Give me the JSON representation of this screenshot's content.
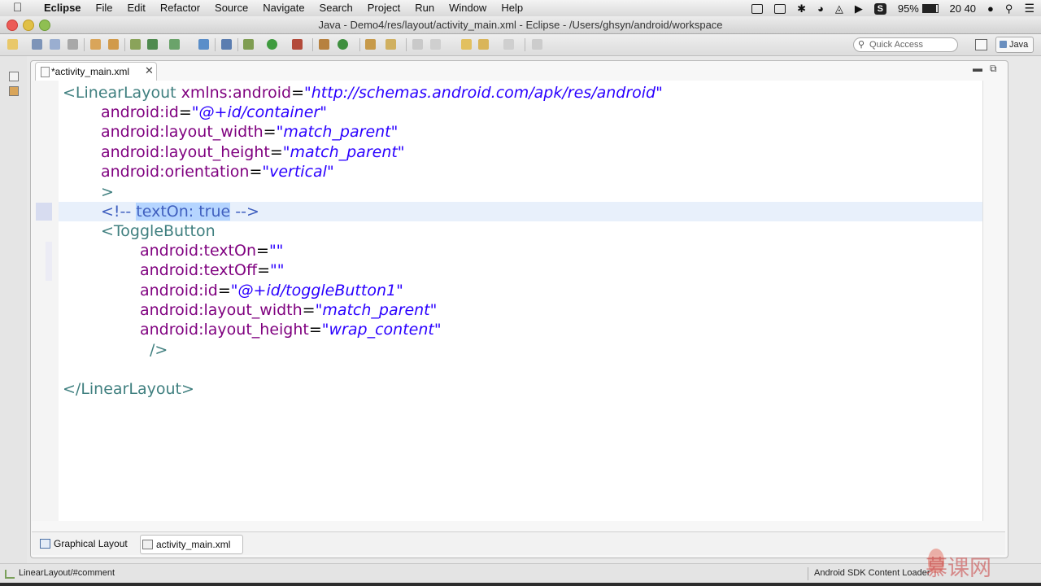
{
  "menubar": {
    "app_name": "Eclipse",
    "menus": [
      "File",
      "Edit",
      "Refactor",
      "Source",
      "Navigate",
      "Search",
      "Project",
      "Run",
      "Window",
      "Help"
    ],
    "input_badge": "S",
    "battery": "95%",
    "clock": "20 40"
  },
  "window": {
    "title": "Java - Demo4/res/layout/activity_main.xml - Eclipse - /Users/ghsyn/android/workspace"
  },
  "toolbar": {
    "quick_access_placeholder": "Quick Access",
    "perspective_label": "Java"
  },
  "editor": {
    "tab_label": "*activity_main.xml",
    "lines": {
      "l1": {
        "open": "<LinearLayout",
        "attr": "xmlns:android",
        "eq": "=",
        "value": "\"http://schemas.android.com/apk/res/android\""
      },
      "l2": {
        "attr": "android:id",
        "eq": "=",
        "value": "\"@+id/container\""
      },
      "l3": {
        "attr": "android:layout_width",
        "eq": "=",
        "value": "\"match_parent\""
      },
      "l4": {
        "attr": "android:layout_height",
        "eq": "=",
        "value": "\"match_parent\""
      },
      "l5": {
        "attr": "android:orientation",
        "eq": "=",
        "value": "\"vertical\""
      },
      "l6": {
        "text": ">"
      },
      "l7": {
        "open": "<!-- ",
        "selected": "textOn: true",
        "close": " -->"
      },
      "l8": {
        "text": "<ToggleButton"
      },
      "l9": {
        "attr": "android:textOn",
        "eq": "=",
        "value": "\"\""
      },
      "l10": {
        "attr": "android:textOff",
        "eq": "=",
        "value": "\"\""
      },
      "l11": {
        "attr": "android:id",
        "eq": "=",
        "value": "\"@+id/toggleButton1\""
      },
      "l12": {
        "attr": "android:layout_width",
        "eq": "=",
        "value": "\"match_parent\""
      },
      "l13": {
        "attr": "android:layout_height",
        "eq": "=",
        "value": "\"wrap_content\""
      },
      "l14": {
        "text": "/>"
      },
      "l15": {
        "text": "</LinearLayout>"
      }
    }
  },
  "bottom_tabs": {
    "graphical": "Graphical Layout",
    "xml": "activity_main.xml"
  },
  "status": {
    "left": "LinearLayout/#comment",
    "right": "Android SDK Content Loader",
    "watermark": "慕课网"
  },
  "colors": {
    "tag": "#3f7f7f",
    "attribute": "#7f007f",
    "value": "#2a00ff",
    "comment": "#3f5fbf",
    "selection": "#b5d5ff",
    "current_line": "#e8f0fb"
  }
}
